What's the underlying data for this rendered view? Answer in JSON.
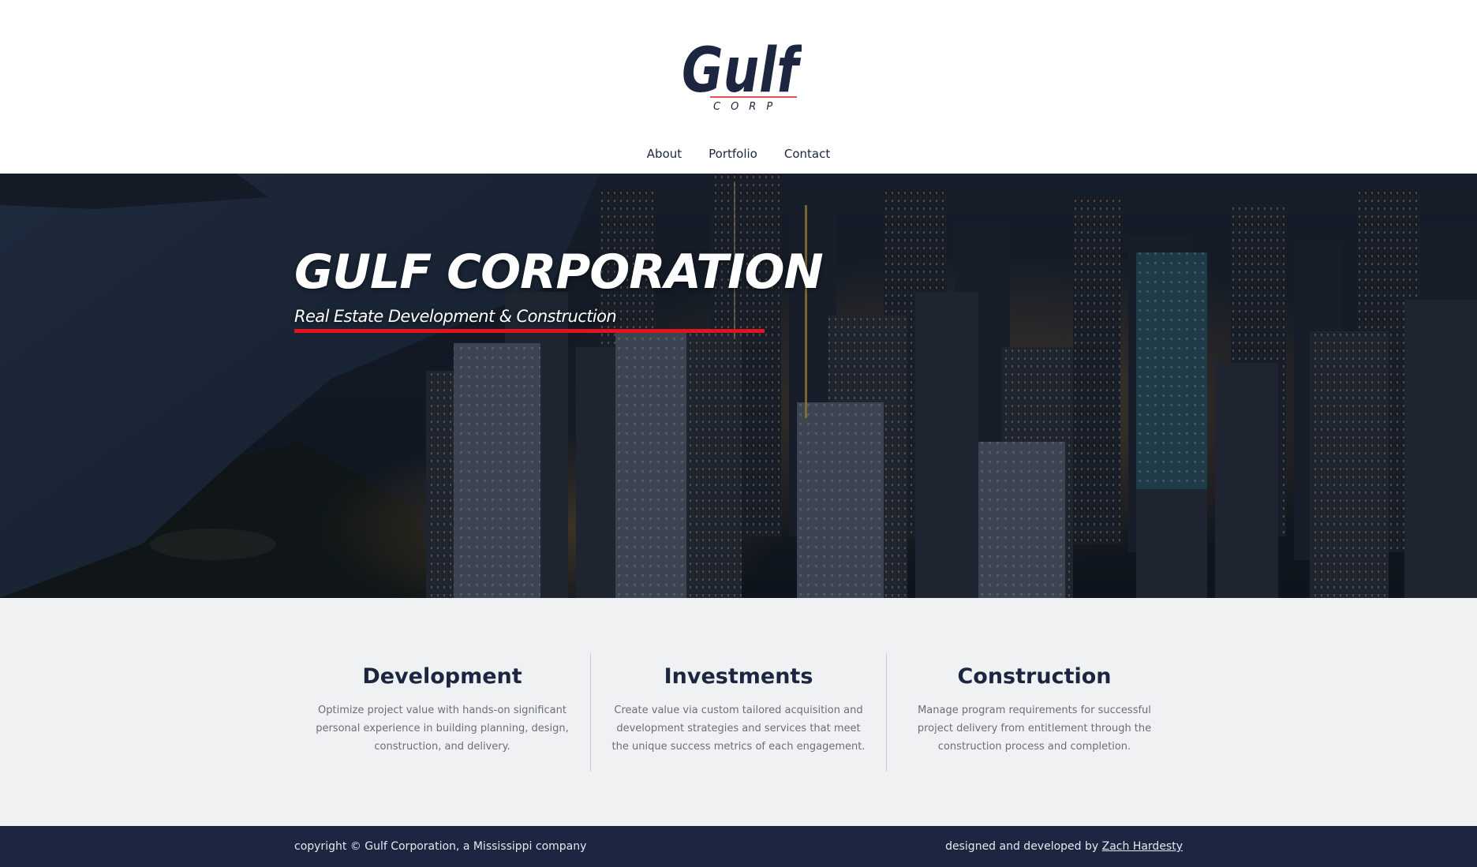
{
  "brand": {
    "logo_word": "Gulf",
    "logo_sub": "CORP",
    "navy": "#1c2640",
    "accent_red": "#e0141e"
  },
  "nav": {
    "items": [
      "About",
      "Portfolio",
      "Contact"
    ]
  },
  "hero": {
    "title": "GULF CORPORATION",
    "subtitle": "Real Estate Development & Construction",
    "background": "night aerial city skyline"
  },
  "services": [
    {
      "heading": "Development",
      "body": "Optimize project value with hands-on significant personal experience in building planning, design, construction, and delivery."
    },
    {
      "heading": "Investments",
      "body": "Create value via custom tailored acquisition and development strategies and services that meet the unique success metrics of each engagement."
    },
    {
      "heading": "Construction",
      "body": "Manage program requirements for successful project delivery from entitlement through the construction process and completion."
    }
  ],
  "footer": {
    "copyright": "copyright © Gulf Corporation, a Mississippi company",
    "credit_prefix": "designed and developed by ",
    "credit_link": "Zach Hardesty"
  }
}
